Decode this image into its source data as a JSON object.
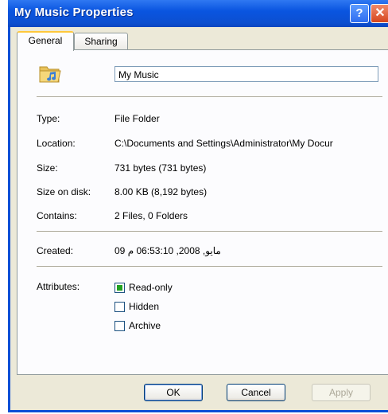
{
  "window": {
    "title": "My Music Properties",
    "help_label": "?",
    "close_label": "✕"
  },
  "tabs": [
    {
      "label": "General",
      "active": true
    },
    {
      "label": "Sharing",
      "active": false
    }
  ],
  "general": {
    "icon": "music-folder-icon",
    "name_value": "My Music",
    "rows": {
      "type": {
        "label": "Type:",
        "value": "File Folder"
      },
      "location": {
        "label": "Location:",
        "value": "C:\\Documents and Settings\\Administrator\\My Docur"
      },
      "size": {
        "label": "Size:",
        "value": "731 bytes (731 bytes)"
      },
      "size_on_disk": {
        "label": "Size on disk:",
        "value": "8.00 KB (8,192 bytes)"
      },
      "contains": {
        "label": "Contains:",
        "value": "2 Files, 0 Folders"
      },
      "created": {
        "label": "Created:",
        "value": "09 مايو, 2008, 06:53:10 م"
      }
    },
    "attributes": {
      "label": "Attributes:",
      "items": [
        {
          "label": "Read-only",
          "checked": true
        },
        {
          "label": "Hidden",
          "checked": false
        },
        {
          "label": "Archive",
          "checked": false
        }
      ]
    }
  },
  "buttons": {
    "ok": "OK",
    "cancel": "Cancel",
    "apply": "Apply"
  },
  "colors": {
    "titlebar": "#0a55e0",
    "dialog_bg": "#ece9d8",
    "readonly_check": "#21a121"
  }
}
